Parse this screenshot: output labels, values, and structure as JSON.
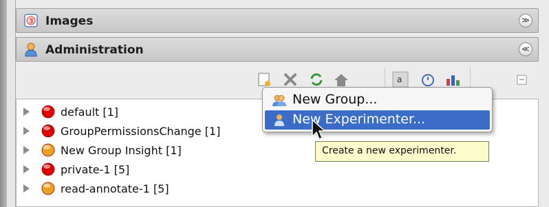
{
  "sections": {
    "images": {
      "title": "Images",
      "collapse_glyph": "≫",
      "icon": "images-icon"
    },
    "administration": {
      "title": "Administration",
      "collapse_glyph": "≪",
      "icon": "administration-icon"
    }
  },
  "toolbar": {
    "buttons": [
      "new-icon",
      "delete-icon",
      "refresh-icon",
      "home-icon",
      "rename-icon",
      "timer-icon",
      "chart-icon",
      "collapse-all-icon"
    ]
  },
  "groups": [
    {
      "label": "default [1]",
      "icon": "private-group-icon",
      "color": "#e00000"
    },
    {
      "label": "GroupPermissionsChange [1]",
      "icon": "private-group-icon",
      "color": "#e00000"
    },
    {
      "label": "New Group Insight [1]",
      "icon": "read-annotate-group-icon",
      "color": "#f0a020"
    },
    {
      "label": "private-1 [5]",
      "icon": "private-group-icon",
      "color": "#e00000"
    },
    {
      "label": "read-annotate-1 [5]",
      "icon": "read-annotate-group-icon",
      "color": "#f0a020"
    }
  ],
  "menu": {
    "items": [
      {
        "label": "New Group...",
        "icon": "group-icon",
        "highlighted": false
      },
      {
        "label": "New Experimenter...",
        "icon": "experimenter-icon",
        "highlighted": true
      }
    ]
  },
  "tooltip": {
    "text": "Create a new experimenter."
  },
  "colors": {
    "highlight": "#3b6dc8",
    "tooltip_bg": "#fbfbcc"
  }
}
